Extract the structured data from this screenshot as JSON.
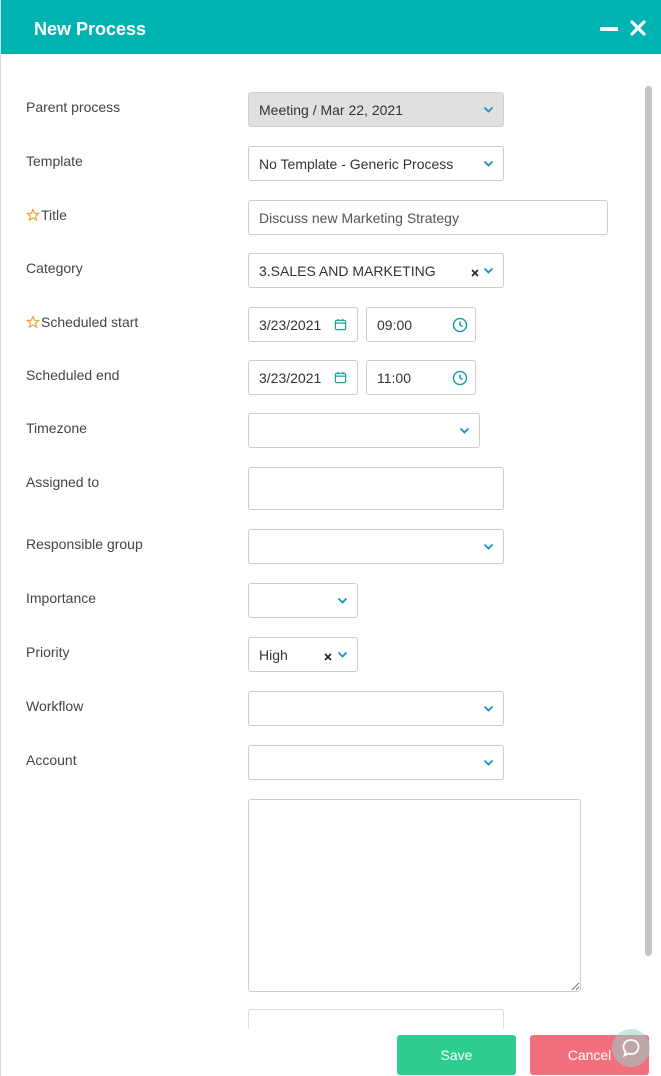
{
  "dialog": {
    "title": "New Process"
  },
  "form": {
    "parent_process": {
      "label": "Parent process",
      "value": "Meeting / Mar 22, 2021"
    },
    "template": {
      "label": "Template",
      "value": "No Template - Generic Process"
    },
    "title": {
      "label": "Title",
      "value": "Discuss new Marketing Strategy"
    },
    "category": {
      "label": "Category",
      "value": "3.SALES AND MARKETING"
    },
    "scheduled_start": {
      "label": "Scheduled start",
      "date": "3/23/2021",
      "time": "09:00"
    },
    "scheduled_end": {
      "label": "Scheduled end",
      "date": "3/23/2021",
      "time": "11:00"
    },
    "timezone": {
      "label": "Timezone",
      "value": ""
    },
    "assigned_to": {
      "label": "Assigned to",
      "value": ""
    },
    "responsible_group": {
      "label": "Responsible group",
      "value": ""
    },
    "importance": {
      "label": "Importance",
      "value": ""
    },
    "priority": {
      "label": "Priority",
      "value": "High"
    },
    "workflow": {
      "label": "Workflow",
      "value": ""
    },
    "account": {
      "label": "Account",
      "value": ""
    },
    "notes": {
      "value": ""
    }
  },
  "actions": {
    "save": "Save",
    "cancel": "Cancel"
  },
  "icons": {
    "minimize": "minimize-icon",
    "close": "close-icon",
    "required": "star-icon",
    "dropdown": "chevron-down-icon",
    "clear": "clear-icon",
    "calendar": "calendar-icon",
    "clock": "clock-icon",
    "chat": "chat-icon"
  },
  "colors": {
    "header": "#00b3b3",
    "required_star": "#f0a030",
    "accent_icon": "#1a8fc9",
    "save": "#2dcc8f",
    "cancel": "#f2707d"
  }
}
